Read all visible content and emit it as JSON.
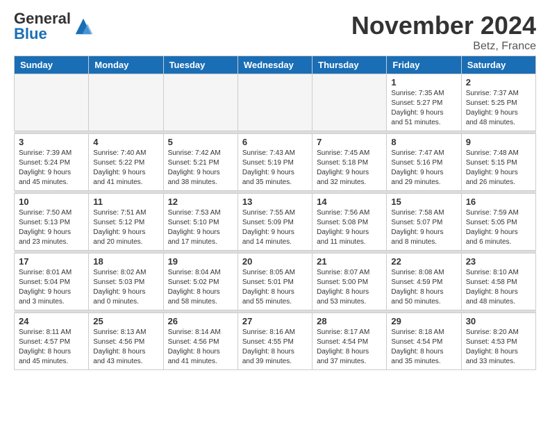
{
  "header": {
    "logo_general": "General",
    "logo_blue": "Blue",
    "month_title": "November 2024",
    "location": "Betz, France"
  },
  "weekdays": [
    "Sunday",
    "Monday",
    "Tuesday",
    "Wednesday",
    "Thursday",
    "Friday",
    "Saturday"
  ],
  "weeks": [
    {
      "cells": [
        {
          "day": "",
          "empty": true
        },
        {
          "day": "",
          "empty": true
        },
        {
          "day": "",
          "empty": true
        },
        {
          "day": "",
          "empty": true
        },
        {
          "day": "",
          "empty": true
        },
        {
          "day": "1",
          "sunrise": "Sunrise: 7:35 AM",
          "sunset": "Sunset: 5:27 PM",
          "daylight": "Daylight: 9 hours and 51 minutes."
        },
        {
          "day": "2",
          "sunrise": "Sunrise: 7:37 AM",
          "sunset": "Sunset: 5:25 PM",
          "daylight": "Daylight: 9 hours and 48 minutes."
        }
      ]
    },
    {
      "cells": [
        {
          "day": "3",
          "sunrise": "Sunrise: 7:39 AM",
          "sunset": "Sunset: 5:24 PM",
          "daylight": "Daylight: 9 hours and 45 minutes."
        },
        {
          "day": "4",
          "sunrise": "Sunrise: 7:40 AM",
          "sunset": "Sunset: 5:22 PM",
          "daylight": "Daylight: 9 hours and 41 minutes."
        },
        {
          "day": "5",
          "sunrise": "Sunrise: 7:42 AM",
          "sunset": "Sunset: 5:21 PM",
          "daylight": "Daylight: 9 hours and 38 minutes."
        },
        {
          "day": "6",
          "sunrise": "Sunrise: 7:43 AM",
          "sunset": "Sunset: 5:19 PM",
          "daylight": "Daylight: 9 hours and 35 minutes."
        },
        {
          "day": "7",
          "sunrise": "Sunrise: 7:45 AM",
          "sunset": "Sunset: 5:18 PM",
          "daylight": "Daylight: 9 hours and 32 minutes."
        },
        {
          "day": "8",
          "sunrise": "Sunrise: 7:47 AM",
          "sunset": "Sunset: 5:16 PM",
          "daylight": "Daylight: 9 hours and 29 minutes."
        },
        {
          "day": "9",
          "sunrise": "Sunrise: 7:48 AM",
          "sunset": "Sunset: 5:15 PM",
          "daylight": "Daylight: 9 hours and 26 minutes."
        }
      ]
    },
    {
      "cells": [
        {
          "day": "10",
          "sunrise": "Sunrise: 7:50 AM",
          "sunset": "Sunset: 5:13 PM",
          "daylight": "Daylight: 9 hours and 23 minutes."
        },
        {
          "day": "11",
          "sunrise": "Sunrise: 7:51 AM",
          "sunset": "Sunset: 5:12 PM",
          "daylight": "Daylight: 9 hours and 20 minutes."
        },
        {
          "day": "12",
          "sunrise": "Sunrise: 7:53 AM",
          "sunset": "Sunset: 5:10 PM",
          "daylight": "Daylight: 9 hours and 17 minutes."
        },
        {
          "day": "13",
          "sunrise": "Sunrise: 7:55 AM",
          "sunset": "Sunset: 5:09 PM",
          "daylight": "Daylight: 9 hours and 14 minutes."
        },
        {
          "day": "14",
          "sunrise": "Sunrise: 7:56 AM",
          "sunset": "Sunset: 5:08 PM",
          "daylight": "Daylight: 9 hours and 11 minutes."
        },
        {
          "day": "15",
          "sunrise": "Sunrise: 7:58 AM",
          "sunset": "Sunset: 5:07 PM",
          "daylight": "Daylight: 9 hours and 8 minutes."
        },
        {
          "day": "16",
          "sunrise": "Sunrise: 7:59 AM",
          "sunset": "Sunset: 5:05 PM",
          "daylight": "Daylight: 9 hours and 6 minutes."
        }
      ]
    },
    {
      "cells": [
        {
          "day": "17",
          "sunrise": "Sunrise: 8:01 AM",
          "sunset": "Sunset: 5:04 PM",
          "daylight": "Daylight: 9 hours and 3 minutes."
        },
        {
          "day": "18",
          "sunrise": "Sunrise: 8:02 AM",
          "sunset": "Sunset: 5:03 PM",
          "daylight": "Daylight: 9 hours and 0 minutes."
        },
        {
          "day": "19",
          "sunrise": "Sunrise: 8:04 AM",
          "sunset": "Sunset: 5:02 PM",
          "daylight": "Daylight: 8 hours and 58 minutes."
        },
        {
          "day": "20",
          "sunrise": "Sunrise: 8:05 AM",
          "sunset": "Sunset: 5:01 PM",
          "daylight": "Daylight: 8 hours and 55 minutes."
        },
        {
          "day": "21",
          "sunrise": "Sunrise: 8:07 AM",
          "sunset": "Sunset: 5:00 PM",
          "daylight": "Daylight: 8 hours and 53 minutes."
        },
        {
          "day": "22",
          "sunrise": "Sunrise: 8:08 AM",
          "sunset": "Sunset: 4:59 PM",
          "daylight": "Daylight: 8 hours and 50 minutes."
        },
        {
          "day": "23",
          "sunrise": "Sunrise: 8:10 AM",
          "sunset": "Sunset: 4:58 PM",
          "daylight": "Daylight: 8 hours and 48 minutes."
        }
      ]
    },
    {
      "cells": [
        {
          "day": "24",
          "sunrise": "Sunrise: 8:11 AM",
          "sunset": "Sunset: 4:57 PM",
          "daylight": "Daylight: 8 hours and 45 minutes."
        },
        {
          "day": "25",
          "sunrise": "Sunrise: 8:13 AM",
          "sunset": "Sunset: 4:56 PM",
          "daylight": "Daylight: 8 hours and 43 minutes."
        },
        {
          "day": "26",
          "sunrise": "Sunrise: 8:14 AM",
          "sunset": "Sunset: 4:56 PM",
          "daylight": "Daylight: 8 hours and 41 minutes."
        },
        {
          "day": "27",
          "sunrise": "Sunrise: 8:16 AM",
          "sunset": "Sunset: 4:55 PM",
          "daylight": "Daylight: 8 hours and 39 minutes."
        },
        {
          "day": "28",
          "sunrise": "Sunrise: 8:17 AM",
          "sunset": "Sunset: 4:54 PM",
          "daylight": "Daylight: 8 hours and 37 minutes."
        },
        {
          "day": "29",
          "sunrise": "Sunrise: 8:18 AM",
          "sunset": "Sunset: 4:54 PM",
          "daylight": "Daylight: 8 hours and 35 minutes."
        },
        {
          "day": "30",
          "sunrise": "Sunrise: 8:20 AM",
          "sunset": "Sunset: 4:53 PM",
          "daylight": "Daylight: 8 hours and 33 minutes."
        }
      ]
    }
  ]
}
